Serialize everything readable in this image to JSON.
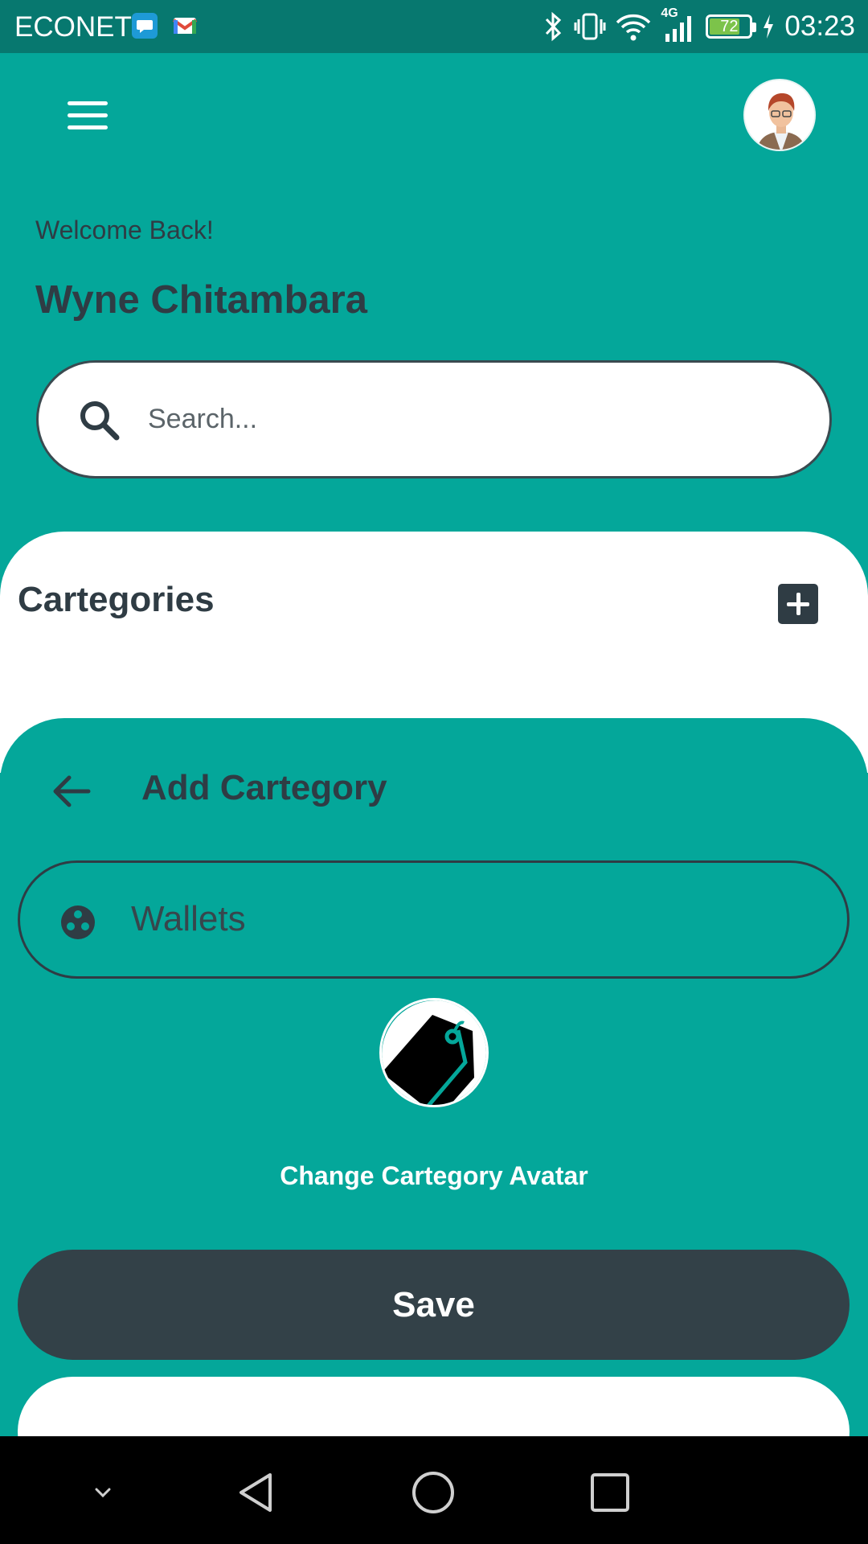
{
  "status_bar": {
    "carrier": "ECONET",
    "network": "4G",
    "battery": "72",
    "time": "03:23"
  },
  "header": {
    "welcome": "Welcome Back!",
    "user_name": "Wyne Chitambara"
  },
  "search": {
    "placeholder": "Search..."
  },
  "categories": {
    "title": "Cartegories"
  },
  "add_category": {
    "title": "Add Cartegory",
    "name_value": "Wallets",
    "change_avatar": "Change Cartegory Avatar",
    "save_label": "Save"
  },
  "colors": {
    "primary": "#04a79a",
    "dark": "#334148",
    "status_bar": "#07786f"
  },
  "icons": [
    "menu-icon",
    "search-icon",
    "plus-icon",
    "arrow-left-icon",
    "palette-icon",
    "tag-icon",
    "back-nav-icon",
    "home-nav-icon",
    "recents-nav-icon",
    "chevron-down-icon"
  ]
}
